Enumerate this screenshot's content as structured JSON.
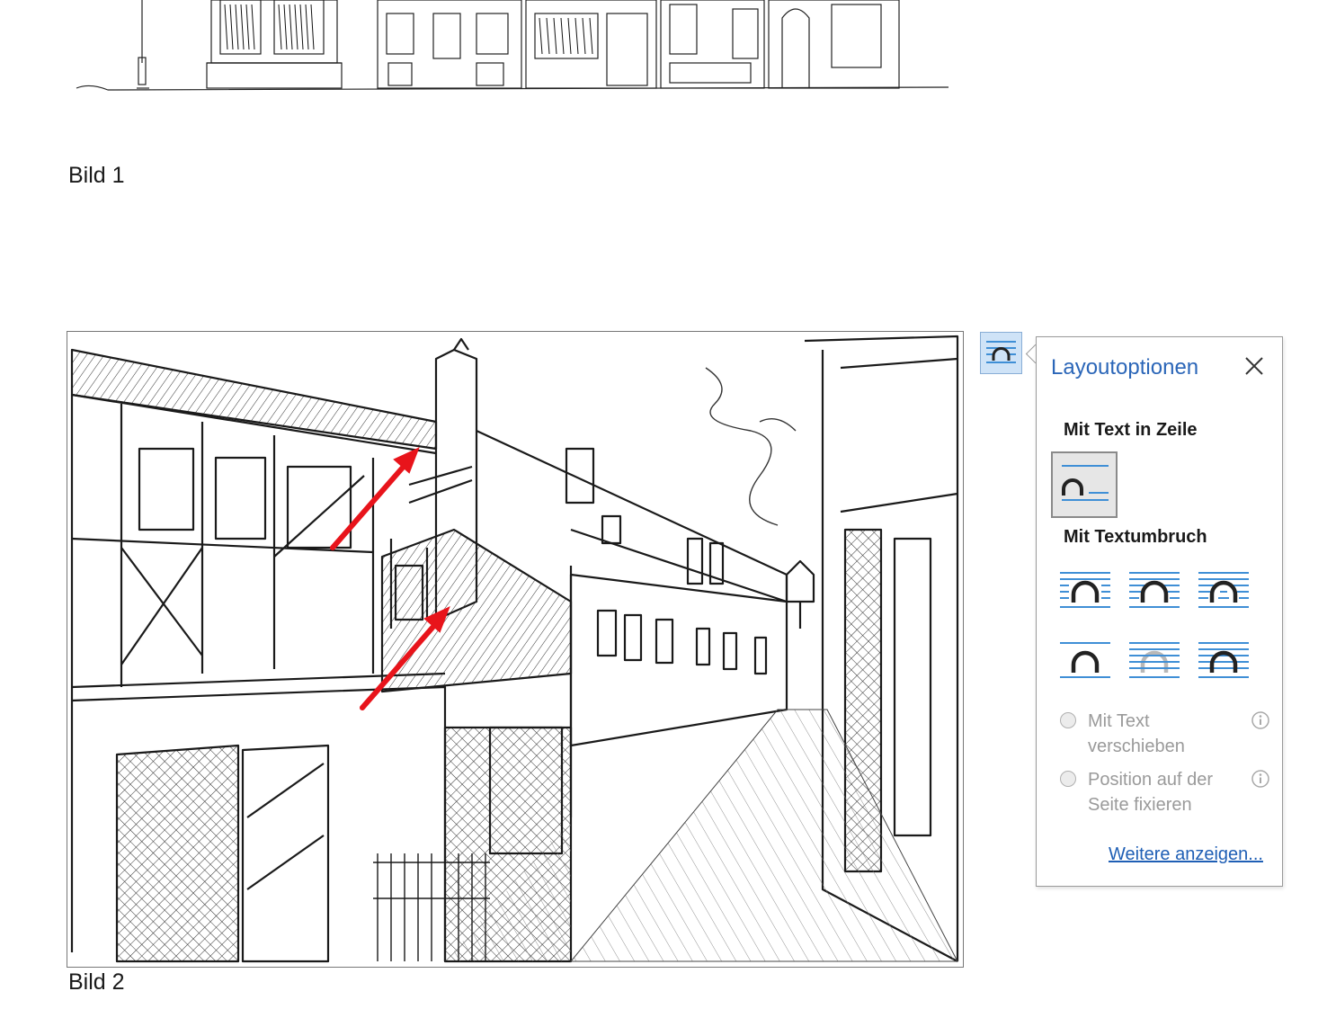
{
  "captions": {
    "bild1": "Bild 1",
    "bild2": "Bild 2"
  },
  "layout_panel": {
    "title": "Layoutoptionen",
    "section_inline": "Mit Text in Zeile",
    "section_wrap": "Mit Textumbruch",
    "inline_option": "inline-with-text-icon",
    "wrap_options": [
      "square-wrap-icon",
      "tight-wrap-icon",
      "through-wrap-icon",
      "top-bottom-wrap-icon",
      "behind-text-icon",
      "in-front-of-text-icon"
    ],
    "radio_move": {
      "label_line1": "Mit Text",
      "label_line2": "verschieben"
    },
    "radio_fix": {
      "label_line1": "Position auf der",
      "label_line2": "Seite fixieren"
    },
    "more_link": "Weitere anzeigen..."
  },
  "colors": {
    "accent": "#2b66b8",
    "wrap_lines": "#3f8fd6",
    "arrows": "#e8141b"
  }
}
